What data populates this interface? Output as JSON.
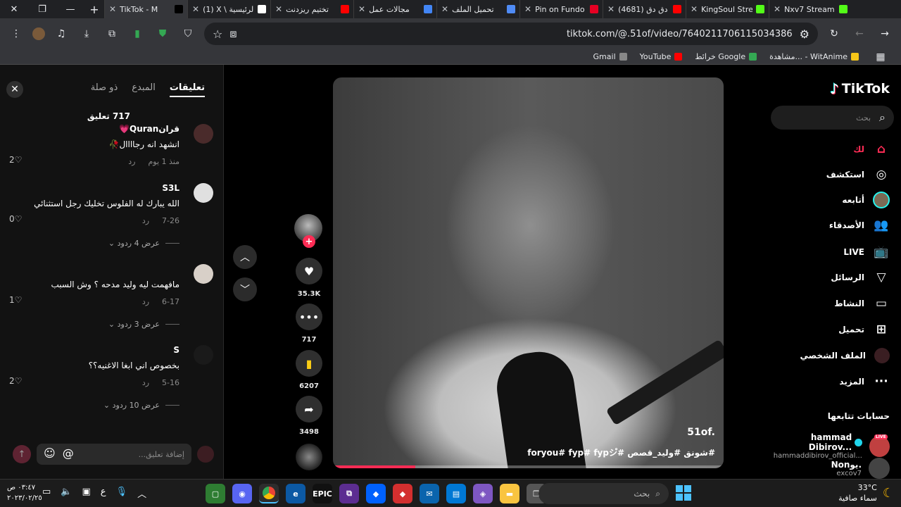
{
  "browser": {
    "tabs": [
      {
        "title": "TikTok - M",
        "color": "#000000",
        "active": true
      },
      {
        "title": "(1) X \\ الرئيسية",
        "color": "#ffffff"
      },
      {
        "title": "تختيم ريزدنت",
        "color": "#ff0000"
      },
      {
        "title": "مجالات عمل",
        "color": "#4285f4"
      },
      {
        "title": "تحميل الملف",
        "color": "#4f8bf5"
      },
      {
        "title": "Pin on Fundo",
        "color": "#e60023"
      },
      {
        "title": "(4681) دق دق",
        "color": "#ff0000"
      },
      {
        "title": "KingSoul Stre",
        "color": "#53fc18"
      },
      {
        "title": "Nxv7 Stream",
        "color": "#53fc18"
      }
    ],
    "url": "tiktok.com/@.51of/video/7640211706115034386",
    "bookmarks": [
      {
        "label": "Gmail",
        "color": "#888888"
      },
      {
        "label": "YouTube",
        "color": "#ff0000"
      },
      {
        "label": "خرائط Google",
        "color": "#34a853"
      },
      {
        "label": "مشاهدة... - WitAnime",
        "color": "#f5c518"
      }
    ]
  },
  "comments": {
    "tabs": {
      "active": "تعليقات",
      "creator": "المبدع",
      "related": "ذو صلة"
    },
    "count_label": "717 تعليق",
    "items": [
      {
        "user": "قرانQuran💗",
        "text": "انشهد انه رجاااال🥀",
        "time": "منذ 1 يوم",
        "reply": "رد",
        "likes": "2♡",
        "replies": ""
      },
      {
        "user": "S3L",
        "text": "الله يبارك له الفلوس تخليك رجل استثنائي",
        "time": "7-26",
        "reply": "رد",
        "likes": "0♡",
        "replies": "عرض 4 ردود ⌄"
      },
      {
        "user": "",
        "text": "مافهمت ليه وليد مدحه ؟ وش السبب",
        "time": "6-17",
        "reply": "رد",
        "likes": "1♡",
        "replies": "عرض 3 ردود ⌄"
      },
      {
        "user": "S",
        "text": "بخصوص اني ابغا الاغنيه؟؟",
        "time": "5-16",
        "reply": "رد",
        "likes": "2♡",
        "replies": "عرض 10 ردود ⌄"
      }
    ],
    "input_placeholder": "إضافة تعليق...",
    "emoji_icon": "☺",
    "mention_icon": "@"
  },
  "actions": {
    "likes": "35.3K",
    "comments": "717",
    "saves": "6207",
    "shares": "3498"
  },
  "video": {
    "author": "51of.",
    "caption": "#شونق #وليد_قصص #foryou# fyp# fypシ゚",
    "progress": 0.21
  },
  "sidebar": {
    "logo": "TikTok",
    "search_placeholder": "بحث",
    "nav": [
      {
        "label": "لك",
        "icon": "⌂"
      },
      {
        "label": "استكشف",
        "icon": "◎"
      },
      {
        "label": "أتابعه",
        "icon": ""
      },
      {
        "label": "الأصدقاء",
        "icon": "👥"
      },
      {
        "label": "LIVE",
        "icon": "📺"
      },
      {
        "label": "الرسائل",
        "icon": "▽"
      },
      {
        "label": "النشاط",
        "icon": "▭"
      },
      {
        "label": "تحميل",
        "icon": "⊞"
      },
      {
        "label": "الملف الشخصي",
        "icon": ""
      },
      {
        "label": "المزيد",
        "icon": "···"
      }
    ],
    "following_header": "حسابات تتابعها",
    "accounts": [
      {
        "name": "hammad Dibirov...",
        "handle": "hammaddibirov_official...",
        "live": "LIVE"
      },
      {
        "name": "Nonيو.",
        "handle": "excov7",
        "live": ""
      }
    ]
  },
  "taskbar": {
    "time": "٠٣:٤٧ ص",
    "date": "٢٠٢٣/٠٢/٢٥",
    "lang": "ع",
    "search_label": "بحث",
    "temp": "33°C",
    "weather": "سماء صافية"
  }
}
